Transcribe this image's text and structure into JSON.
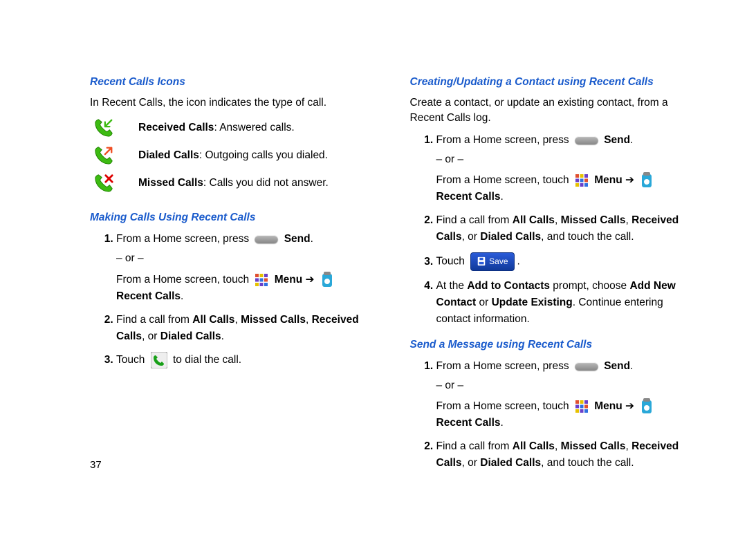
{
  "page_number": "37",
  "left": {
    "h_icons": "Recent Calls Icons",
    "intro": "In Recent Calls, the icon indicates the type of call.",
    "received_b": "Received Calls",
    "received_t": ": Answered calls.",
    "dialed_b": "Dialed Calls",
    "dialed_t": ": Outgoing calls you dialed.",
    "missed_b": "Missed Calls",
    "missed_t": ": Calls you did not answer.",
    "h_make": "Making Calls Using Recent Calls",
    "s1a": "From a Home screen, press ",
    "send": "Send",
    "or": "– or –",
    "s1b": "From a Home screen, touch ",
    "menu": "Menu",
    "arrow": " ➔ ",
    "recent": "Recent Calls",
    "s2a": "Find a call from ",
    "allcalls": "All Calls",
    "missed": "Missed Calls",
    "received": "Received Calls",
    "or_word": ", or ",
    "dialed": "Dialed Calls",
    "s3a": "Touch ",
    "s3b": " to dial the call."
  },
  "right": {
    "h_create": "Creating/Updating a Contact using Recent Calls",
    "intro": "Create a contact, or update an existing contact, from a Recent Calls log.",
    "s2tail": ", and touch the call.",
    "s3a": "Touch ",
    "save": "Save",
    "s4a": "At the ",
    "addto": "Add to Contacts",
    "s4b": " prompt, choose ",
    "addnew": "Add New Contact",
    "s4c": " or ",
    "update": "Update Existing",
    "s4d": ". Continue entering contact information.",
    "h_send": "Send a Message using Recent Calls"
  },
  "period": "."
}
